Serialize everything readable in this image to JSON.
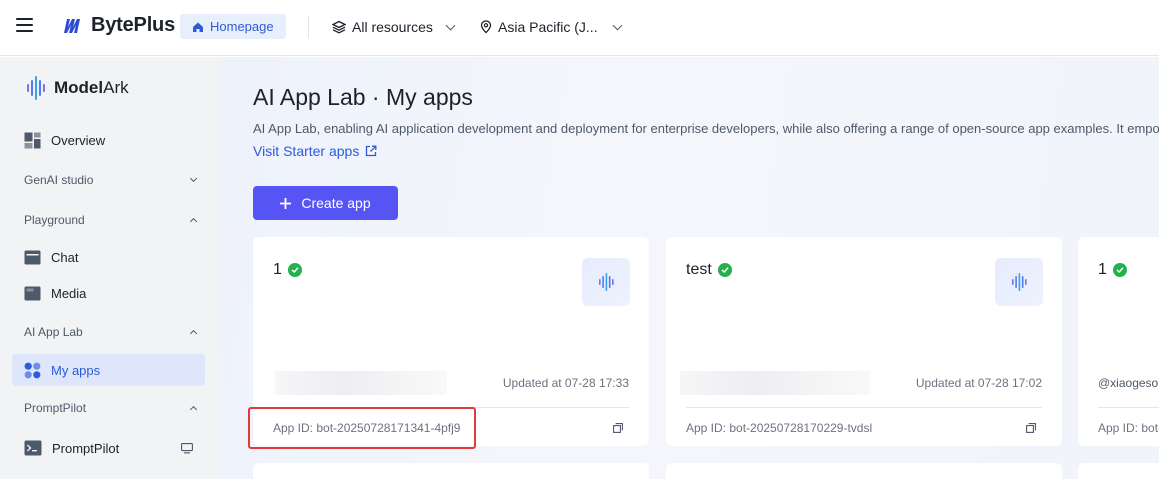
{
  "topbar": {
    "brand": "BytePlus",
    "home_label": "Homepage",
    "resources_label": "All resources",
    "region_label": "Asia Pacific (J..."
  },
  "sidebar": {
    "product_name_bold": "Model",
    "product_name_rest": "Ark",
    "overview": "Overview",
    "groups": {
      "genai": "GenAI studio",
      "playground": "Playground",
      "applab": "AI App Lab",
      "promptpilot": "PromptPilot"
    },
    "items": {
      "chat": "Chat",
      "media": "Media",
      "my_apps": "My apps",
      "promptpilot": "PromptPilot"
    }
  },
  "main": {
    "title": "AI App Lab · My apps",
    "description": "AI App Lab, enabling AI application development and deployment for enterprise developers, while also offering a range of open-source app examples. It empo",
    "starter_link": "Visit Starter apps",
    "create_button": "Create app",
    "cards": [
      {
        "name": "1",
        "owner": "",
        "updated": "Updated at 07-28 17:33",
        "app_id": "App ID: bot-20250728171341-4pfj9"
      },
      {
        "name": "test",
        "owner": "",
        "updated": "Updated at 07-28 17:02",
        "app_id": "App ID: bot-20250728170229-tvdsl"
      },
      {
        "name": "1",
        "owner": "@xiaogeson",
        "updated": "",
        "app_id": "App ID: bot-"
      }
    ]
  },
  "colors": {
    "accent": "#5654f3",
    "link": "#2d5bd9",
    "status_ok": "#23b14d",
    "highlight": "#e03a3a"
  }
}
